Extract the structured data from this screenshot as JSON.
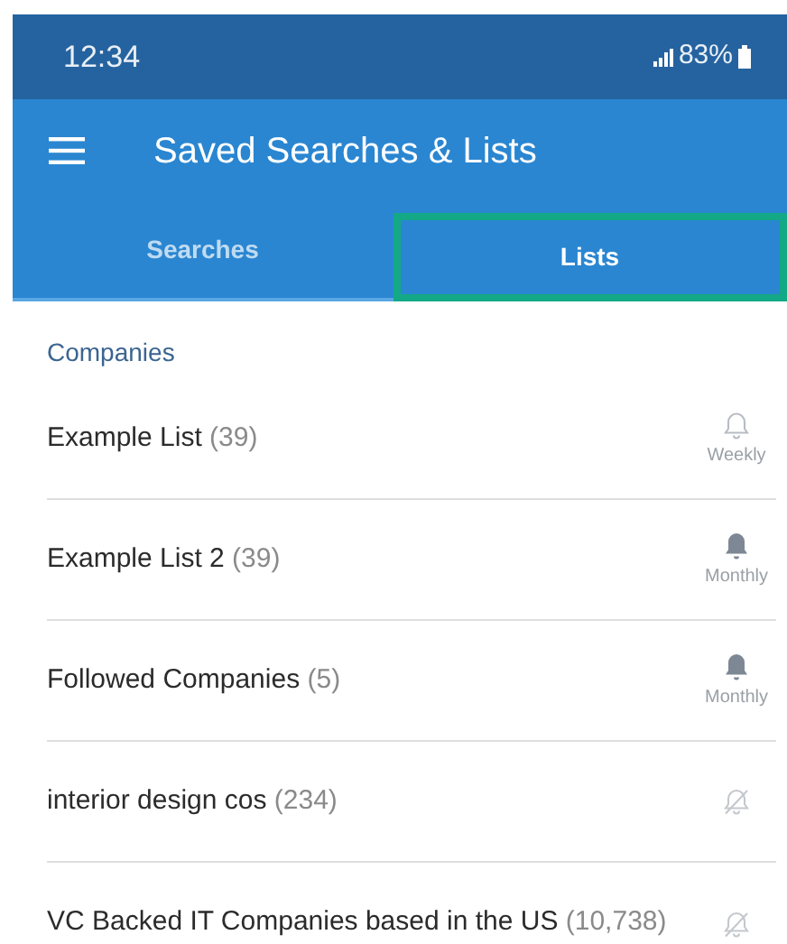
{
  "status_bar": {
    "time": "12:34",
    "battery": "83%"
  },
  "app_bar": {
    "title": "Saved Searches & Lists"
  },
  "tabs": [
    {
      "label": "Searches",
      "selected": false,
      "highlighted": false
    },
    {
      "label": "Lists",
      "selected": true,
      "highlighted": true
    }
  ],
  "section": {
    "title": "Companies"
  },
  "lists": [
    {
      "name": "Example List",
      "count": "(39)",
      "kind": "outline",
      "frequency": "Weekly"
    },
    {
      "name": "Example List 2",
      "count": "(39)",
      "kind": "filled",
      "frequency": "Monthly"
    },
    {
      "name": "Followed Companies",
      "count": "(5)",
      "kind": "filled",
      "frequency": "Monthly"
    },
    {
      "name": "interior design cos",
      "count": "(234)",
      "kind": "muted"
    },
    {
      "name": "VC Backed IT Companies based in the US",
      "count": "(10,738)",
      "kind": "muted"
    }
  ]
}
